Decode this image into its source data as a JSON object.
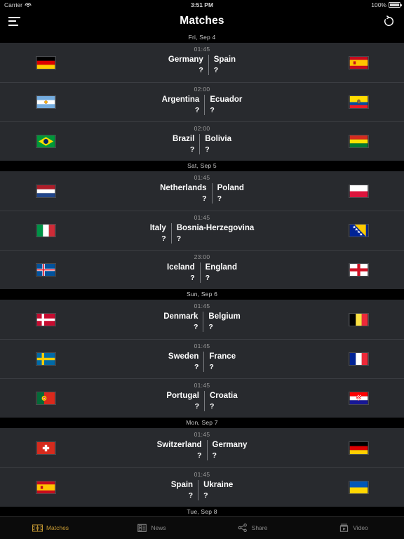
{
  "status_bar": {
    "carrier": "Carrier",
    "time": "3:51 PM",
    "battery": "100%",
    "wifi_icon": "wifi-icon",
    "battery_icon": "battery-icon"
  },
  "nav": {
    "title": "Matches",
    "menu_icon": "hamburger-menu-icon",
    "refresh_icon": "refresh-icon"
  },
  "theme": {
    "accent": "#c79a33",
    "row_bg": "#282a2e",
    "page_bg": "#000000",
    "text": "#ffffff",
    "muted": "#9a9a9a"
  },
  "sections": [
    {
      "date": "Fri, Sep 4",
      "matches": [
        {
          "time": "01:45",
          "home": "Germany",
          "away": "Spain",
          "home_score": "?",
          "away_score": "?",
          "home_flag": "flag-germany",
          "away_flag": "flag-spain"
        },
        {
          "time": "02:00",
          "home": "Argentina",
          "away": "Ecuador",
          "home_score": "?",
          "away_score": "?",
          "home_flag": "flag-argentina",
          "away_flag": "flag-ecuador"
        },
        {
          "time": "02:00",
          "home": "Brazil",
          "away": "Bolivia",
          "home_score": "?",
          "away_score": "?",
          "home_flag": "flag-brazil",
          "away_flag": "flag-bolivia"
        }
      ]
    },
    {
      "date": "Sat, Sep 5",
      "matches": [
        {
          "time": "01:45",
          "home": "Netherlands",
          "away": "Poland",
          "home_score": "?",
          "away_score": "?",
          "home_flag": "flag-netherlands",
          "away_flag": "flag-poland"
        },
        {
          "time": "01:45",
          "home": "Italy",
          "away": "Bosnia-Herzegovina",
          "home_score": "?",
          "away_score": "?",
          "home_flag": "flag-italy",
          "away_flag": "flag-bosnia"
        },
        {
          "time": "23:00",
          "home": "Iceland",
          "away": "England",
          "home_score": "?",
          "away_score": "?",
          "home_flag": "flag-iceland",
          "away_flag": "flag-england"
        }
      ]
    },
    {
      "date": "Sun, Sep 6",
      "matches": [
        {
          "time": "01:45",
          "home": "Denmark",
          "away": "Belgium",
          "home_score": "?",
          "away_score": "?",
          "home_flag": "flag-denmark",
          "away_flag": "flag-belgium"
        },
        {
          "time": "01:45",
          "home": "Sweden",
          "away": "France",
          "home_score": "?",
          "away_score": "?",
          "home_flag": "flag-sweden",
          "away_flag": "flag-france"
        },
        {
          "time": "01:45",
          "home": "Portugal",
          "away": "Croatia",
          "home_score": "?",
          "away_score": "?",
          "home_flag": "flag-portugal",
          "away_flag": "flag-croatia"
        }
      ]
    },
    {
      "date": "Mon, Sep 7",
      "matches": [
        {
          "time": "01:45",
          "home": "Switzerland",
          "away": "Germany",
          "home_score": "?",
          "away_score": "?",
          "home_flag": "flag-switzerland",
          "away_flag": "flag-germany"
        },
        {
          "time": "01:45",
          "home": "Spain",
          "away": "Ukraine",
          "home_score": "?",
          "away_score": "?",
          "home_flag": "flag-spain",
          "away_flag": "flag-ukraine"
        }
      ]
    },
    {
      "date": "Tue, Sep 8",
      "matches": []
    }
  ],
  "tabs": [
    {
      "label": "Matches",
      "icon": "pitch-icon",
      "active": true
    },
    {
      "label": "News",
      "icon": "newspaper-icon",
      "active": false
    },
    {
      "label": "Share",
      "icon": "share-icon",
      "active": false
    },
    {
      "label": "Video",
      "icon": "video-icon",
      "active": false
    }
  ]
}
